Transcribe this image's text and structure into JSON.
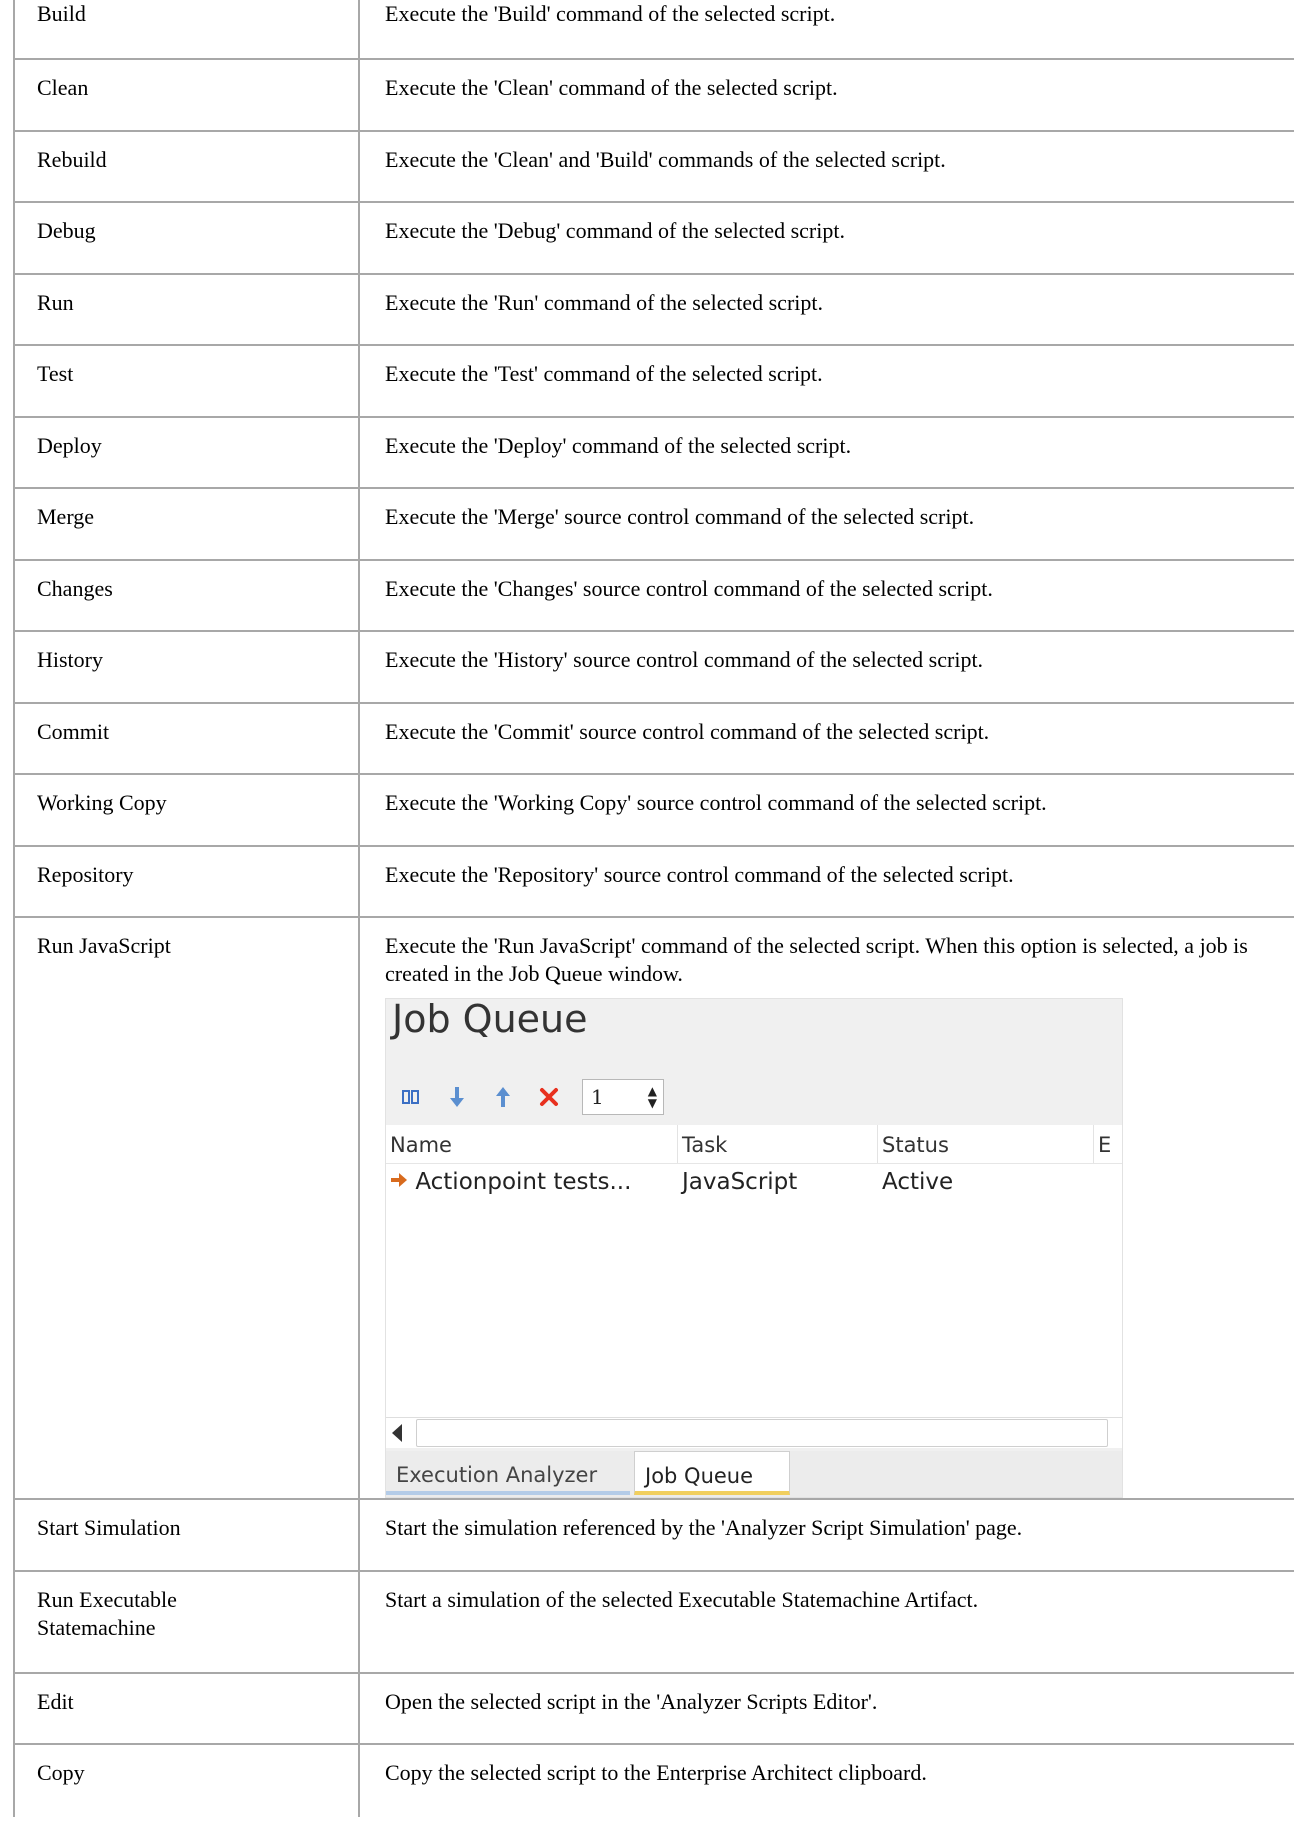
{
  "rows": [
    {
      "command": "Build",
      "description": "Execute the 'Build' command of the selected script."
    },
    {
      "command": "Clean",
      "description": "Execute the 'Clean' command of the selected script."
    },
    {
      "command": "Rebuild",
      "description": "Execute the 'Clean' and 'Build' commands of the selected script."
    },
    {
      "command": "Debug",
      "description": "Execute the 'Debug' command of the selected script."
    },
    {
      "command": "Run",
      "description": "Execute the 'Run' command of the selected script."
    },
    {
      "command": "Test",
      "description": "Execute the 'Test' command of the selected script."
    },
    {
      "command": "Deploy",
      "description": "Execute the 'Deploy' command of the selected script."
    },
    {
      "command": "Merge",
      "description": "Execute the 'Merge' source control command of the selected script."
    },
    {
      "command": "Changes",
      "description": "Execute the 'Changes' source control command of the selected script."
    },
    {
      "command": "History",
      "description": "Execute the 'History' source control command of the selected script."
    },
    {
      "command": "Commit",
      "description": "Execute the 'Commit' source control command of the selected script."
    },
    {
      "command": "Working Copy",
      "description": "Execute the 'Working Copy' source control command of the selected script."
    },
    {
      "command": "Repository",
      "description": "Execute the 'Repository' source control command of the selected script."
    },
    {
      "command": "Run JavaScript",
      "description": "Execute the 'Run JavaScript' command of the selected script. When this option is selected, a job is created in the Job Queue window."
    },
    {
      "command": "Start Simulation",
      "description": "Start the simulation referenced by the 'Analyzer Script Simulation' page."
    },
    {
      "command": "Run Executable Statemachine",
      "description": "Start a simulation of the selected Executable Statemachine Artifact."
    },
    {
      "command": "Edit",
      "description": "Open the selected script in the 'Analyzer Scripts Editor'."
    },
    {
      "command": "Copy",
      "description": "Copy the selected script to the Enterprise Architect clipboard."
    }
  ],
  "job_queue": {
    "title": "Job Queue",
    "spinner_value": "1",
    "columns": [
      "Name",
      "Task",
      "Status",
      "E"
    ],
    "job": {
      "name": "Actionpoint tests...",
      "task": "JavaScript",
      "status": "Active"
    },
    "tabs": [
      "Execution Analyzer",
      "Job Queue"
    ],
    "icons": {
      "pause": "pause-icon",
      "down": "move-down-icon",
      "up": "move-up-icon",
      "delete": "delete-icon",
      "job": "arrow-right-icon"
    },
    "colors": {
      "accent_orange": "#d86b1e",
      "delete_red": "#e8301e",
      "arrow_blue": "#5b8fd0",
      "tab_active": "#f1cf5f",
      "tab_inactive": "#b4cce8"
    }
  }
}
